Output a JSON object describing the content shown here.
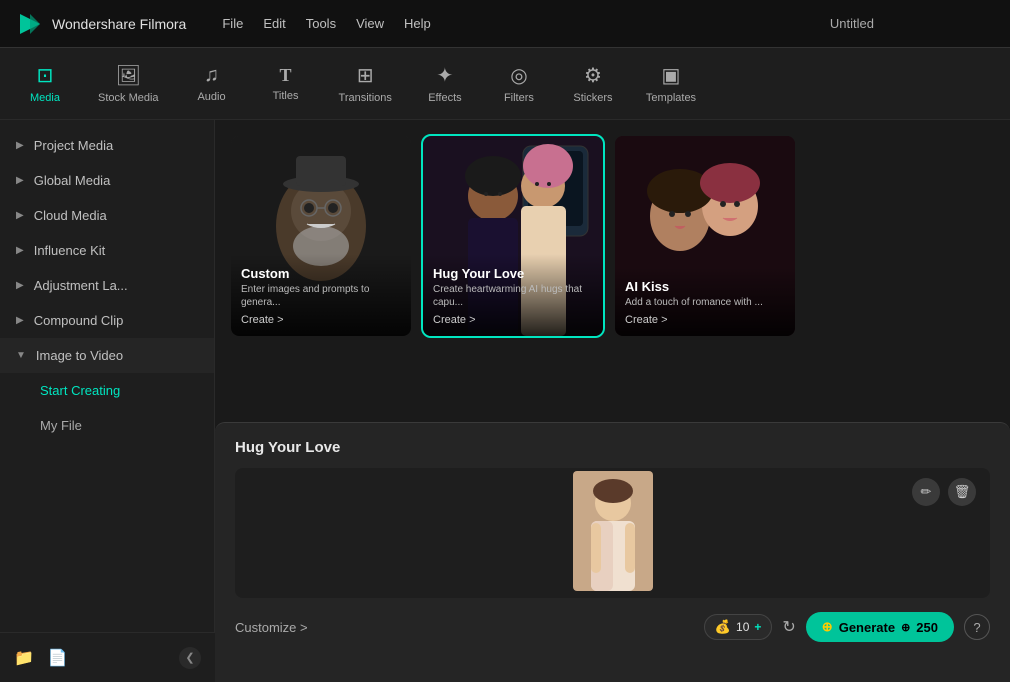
{
  "app": {
    "logo_text": "Wondershare Filmora",
    "window_title": "Untitled",
    "menu": [
      "File",
      "Edit",
      "Tools",
      "View",
      "Help"
    ]
  },
  "nav_tabs": [
    {
      "id": "media",
      "icon": "📷",
      "label": "Media",
      "active": true
    },
    {
      "id": "stock-media",
      "icon": "🖼",
      "label": "Stock Media",
      "active": false
    },
    {
      "id": "audio",
      "icon": "🎵",
      "label": "Audio",
      "active": false
    },
    {
      "id": "titles",
      "icon": "T",
      "label": "Titles",
      "active": false
    },
    {
      "id": "transitions",
      "icon": "▷",
      "label": "Transitions",
      "active": false
    },
    {
      "id": "effects",
      "icon": "✦",
      "label": "Effects",
      "active": false
    },
    {
      "id": "filters",
      "icon": "◎",
      "label": "Filters",
      "active": false
    },
    {
      "id": "stickers",
      "icon": "⚙",
      "label": "Stickers",
      "active": false
    },
    {
      "id": "templates",
      "icon": "▣",
      "label": "Templates",
      "active": false
    }
  ],
  "sidebar": {
    "items": [
      {
        "id": "project-media",
        "label": "Project Media",
        "arrow": "▶",
        "expanded": false
      },
      {
        "id": "global-media",
        "label": "Global Media",
        "arrow": "▶",
        "expanded": false
      },
      {
        "id": "cloud-media",
        "label": "Cloud Media",
        "arrow": "▶",
        "expanded": false
      },
      {
        "id": "influence-kit",
        "label": "Influence Kit",
        "arrow": "▶",
        "expanded": false
      },
      {
        "id": "adjustment-la",
        "label": "Adjustment La...",
        "arrow": "▶",
        "expanded": false
      },
      {
        "id": "compound-clip",
        "label": "Compound Clip",
        "arrow": "▶",
        "expanded": false
      },
      {
        "id": "image-to-video",
        "label": "Image to Video",
        "arrow": "▼",
        "expanded": true
      }
    ],
    "children": [
      {
        "id": "start-creating",
        "label": "Start Creating",
        "active": true
      },
      {
        "id": "my-file",
        "label": "My File",
        "active": false
      }
    ]
  },
  "cards": [
    {
      "id": "custom",
      "title": "Custom",
      "desc": "Enter images and prompts to genera...",
      "create_label": "Create >"
    },
    {
      "id": "hug-your-love",
      "title": "Hug Your Love",
      "desc": "Create heartwarming AI hugs that capu...",
      "create_label": "Create >",
      "selected": true
    },
    {
      "id": "ai-kiss",
      "title": "AI Kiss",
      "desc": "Add a touch of romance with ...",
      "create_label": "Create >"
    }
  ],
  "panel": {
    "title": "Hug Your Love",
    "customize_label": "Customize >",
    "coin_count": "10",
    "plus_sign": "+",
    "generate_label": "Generate",
    "generate_cost": "250",
    "help_label": "?"
  }
}
